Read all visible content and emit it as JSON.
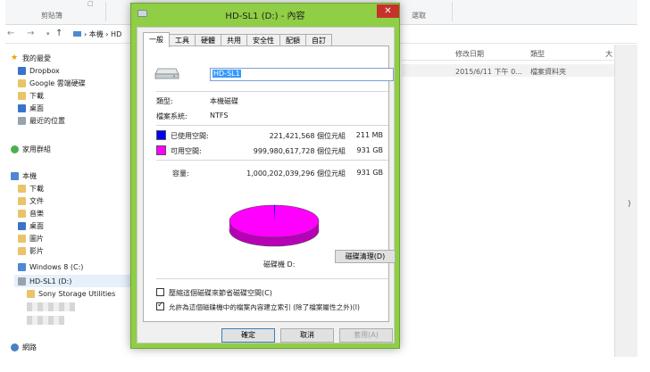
{
  "explorer": {
    "ribbon_group": "剪貼簿",
    "ribbon_group_right": "選取",
    "breadcrumb": [
      "本機",
      "HD"
    ],
    "columns": {
      "date": "修改日期",
      "type": "類型",
      "size": "大"
    },
    "row": {
      "date": "2015/6/11 下午 0...",
      "type": "檔案資料夾"
    },
    "sidebar": {
      "favorites": "我的最愛",
      "fav_items": [
        "Dropbox",
        "Google 雲端硬碟",
        "下載",
        "桌面",
        "最近的位置"
      ],
      "homegroup": "家用群組",
      "pc": "本機",
      "pc_items": [
        "下載",
        "文件",
        "音樂",
        "桌面",
        "圖片",
        "影片",
        "Windows 8 (C:)",
        "HD-SL1 (D:)"
      ],
      "sub_item": "Sony Storage Utilities",
      "network": "網路"
    }
  },
  "dialog": {
    "title": "HD-SL1 (D:) - 內容",
    "close": "✕",
    "tabs": [
      "一般",
      "工具",
      "硬體",
      "共用",
      "安全性",
      "配額",
      "自訂"
    ],
    "name_value": "HD-SL1",
    "type_label": "類型:",
    "type_value": "本機磁碟",
    "fs_label": "檔案系統:",
    "fs_value": "NTFS",
    "used_label": "已使用空間:",
    "used_bytes": "221,421,568 個位元組",
    "used_size": "211 MB",
    "free_label": "可用空間:",
    "free_bytes": "999,980,617,728 個位元組",
    "free_size": "931 GB",
    "cap_label": "容量:",
    "cap_bytes": "1,000,202,039,296 個位元組",
    "cap_size": "931 GB",
    "drive_caption": "磁碟機 D:",
    "cleanup_button": "磁碟清理(D)",
    "compress_label": "壓縮這個磁碟來節省磁碟空間(C)",
    "index_label": "允許為這個磁碟機中的檔案內容建立索引 (除了檔案屬性之外)(I)",
    "compress_checked": false,
    "index_checked": true,
    "ok_button": "確定",
    "cancel_button": "取消",
    "apply_button": "套用(A)"
  },
  "colors": {
    "used": "#0000ff",
    "free": "#ff00ff",
    "frame": "#8fce45"
  }
}
